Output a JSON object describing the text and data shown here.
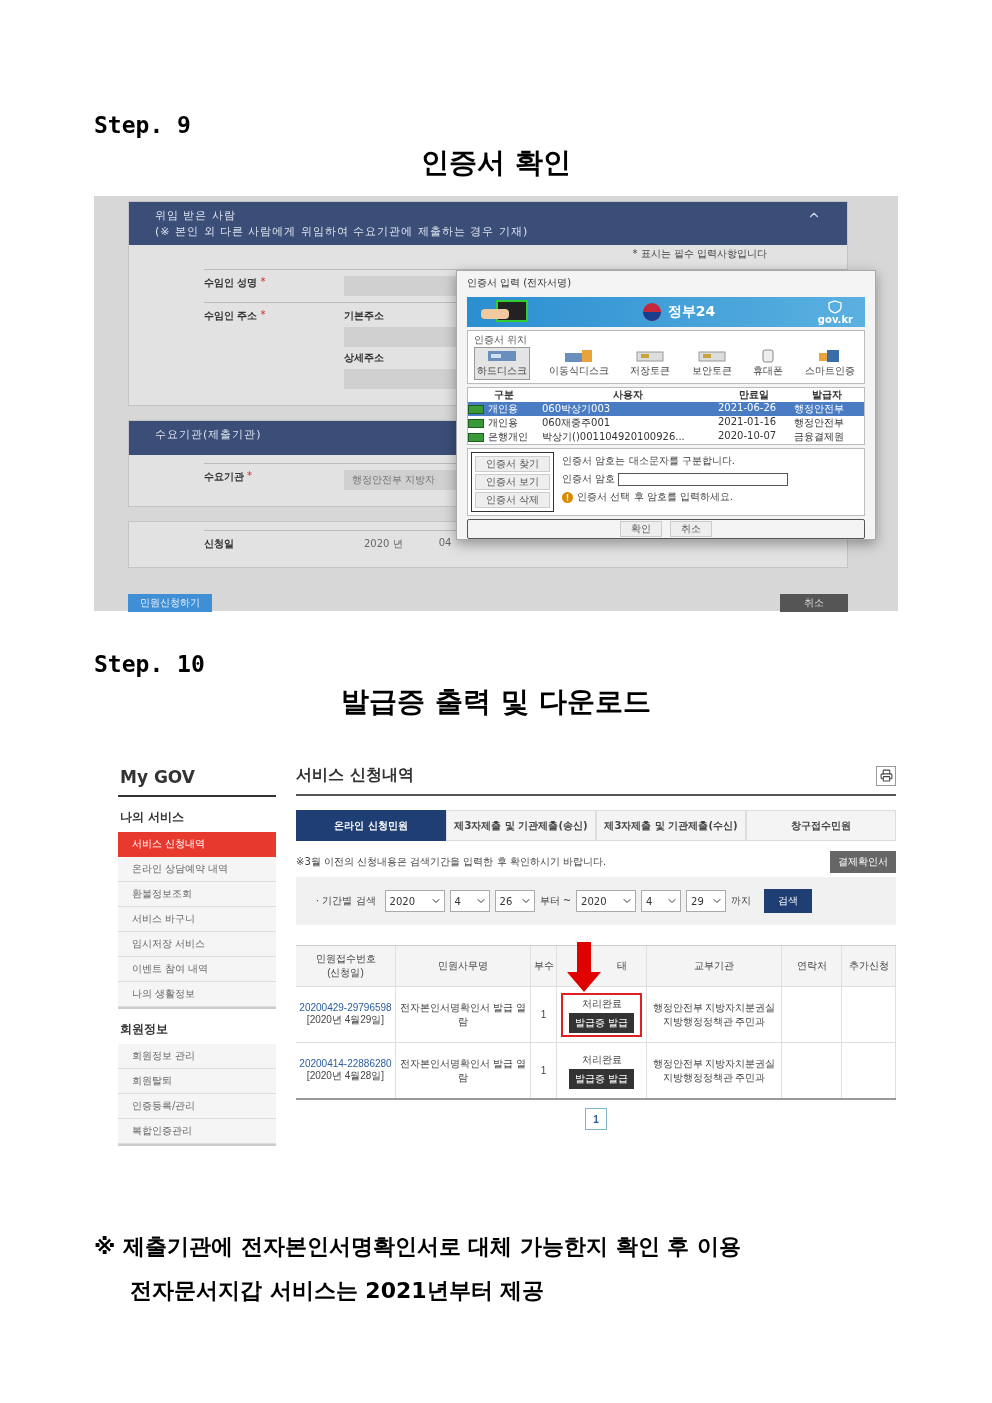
{
  "steps": [
    {
      "label": "Step. 9",
      "title": "인증서 확인"
    },
    {
      "label": "Step. 10",
      "title": "발급증 출력 및 다운로드"
    }
  ],
  "step9": {
    "panels": [
      {
        "header": [
          "위임 받은 사람",
          "(※ 본인 외 다른 사람에게 위임하여 수요기관에 제출하는 경우 기재)"
        ],
        "note": "* 표시는 필수 입력사항입니다",
        "fields": [
          {
            "label": "수임인 성명",
            "mark": "*",
            "kind": "input"
          },
          {
            "label": "수임인 주소",
            "mark": "*",
            "kind": "input",
            "inputs": [
              {
                "sublabel": "기본주소"
              },
              {
                "sublabel": "상세주소"
              }
            ]
          }
        ]
      },
      {
        "header": [
          "수요기관(제출기관)"
        ],
        "fields": [
          {
            "label": "수요기관",
            "mark": "*",
            "kind": "input",
            "value": "행정안전부 지방자"
          }
        ]
      },
      {
        "fields": [
          {
            "label": "신청일",
            "kind": "date",
            "date": [
              "2020 년",
              "04"
            ]
          }
        ]
      }
    ],
    "submit": "민원신청하기",
    "cancel": "취소",
    "dialog": {
      "title": "인증서 입력 (전자서명)",
      "brand": "정부24",
      "brand_domain": "gov.kr",
      "location_legend": "인증서 위치",
      "locations": [
        {
          "kind": "disk",
          "label": "하드디스크",
          "selected": true
        },
        {
          "kind": "removable",
          "label": "이동식디스크",
          "selected": false
        },
        {
          "kind": "token",
          "label": "저장토큰",
          "selected": false
        },
        {
          "kind": "token",
          "label": "보안토큰",
          "selected": false
        },
        {
          "kind": "phone",
          "label": "휴대폰",
          "selected": false
        },
        {
          "kind": "smart",
          "label": "스마트인증",
          "selected": false
        }
      ],
      "columns": [
        "구분",
        "사용자",
        "만료일",
        "발급자"
      ],
      "certificates": [
        {
          "type": "개인용",
          "user": "060박상기003",
          "expires": "2021-06-26",
          "issuer": "행정안전부",
          "selected": true
        },
        {
          "type": "개인용",
          "user": "060재중주001",
          "expires": "2021-01-16",
          "issuer": "행정안전부",
          "selected": false
        },
        {
          "type": "은행개인",
          "user": "박상기()001104920100926...",
          "expires": "2020-10-07",
          "issuer": "금융결제원",
          "selected": false
        }
      ],
      "actions": [
        "인증서 찾기",
        "인증서 보기",
        "인증서 삭제"
      ],
      "case_note": "인증서 암호는 대소문자를 구분합니다.",
      "password_label": "인증서 암호",
      "warning": "인증서 선택 후 암호를 입력하세요.",
      "buttons": [
        "확인",
        "취소"
      ]
    }
  },
  "step10": {
    "brand": "My GOV",
    "sidebar": [
      {
        "title": "나의 서비스",
        "items": [
          {
            "label": "서비스 신청내역",
            "selected": true
          },
          {
            "label": "온라인 상담예약 내역",
            "selected": false
          },
          {
            "label": "환불정보조회",
            "selected": false
          },
          {
            "label": "서비스 바구니",
            "selected": false
          },
          {
            "label": "임시저장 서비스",
            "selected": false
          },
          {
            "label": "이벤트 참여 내역",
            "selected": false
          },
          {
            "label": "나의 생활정보",
            "selected": false
          }
        ]
      },
      {
        "title": "회원정보",
        "items": [
          {
            "label": "회원정보 관리",
            "selected": false
          },
          {
            "label": "회원탈퇴",
            "selected": false
          },
          {
            "label": "인증등록/관리",
            "selected": false
          },
          {
            "label": "복합인증관리",
            "selected": false
          }
        ]
      }
    ],
    "page_title": "서비스 신청내역",
    "tabs": [
      {
        "label": "온라인 신청민원",
        "selected": true
      },
      {
        "label": "제3자제출 및 기관제출(송신)",
        "selected": false
      },
      {
        "label": "제3자제출 및 기관제출(수신)",
        "selected": false
      },
      {
        "label": "창구접수민원",
        "selected": false
      }
    ],
    "notice": "※3월 이전의 신청내용은 검색기간을 입력한 후 확인하시기 바랍니다.",
    "receipt_button": "결제확인서",
    "search": {
      "label": "· 기간별 검색",
      "from": [
        "2020",
        "4",
        "26"
      ],
      "from_suffix": "부터 ~",
      "to": [
        "2020",
        "4",
        "29"
      ],
      "to_suffix": "까지",
      "button": "검색"
    },
    "columns": [
      [
        "민원접수번호",
        "(신청일)"
      ],
      [
        "민원사무명"
      ],
      [
        "부수"
      ],
      [
        "태"
      ],
      [
        "교부기관"
      ],
      [
        "연락처"
      ],
      [
        "추가신청"
      ]
    ],
    "rows": [
      {
        "number": "20200429-29796598",
        "date": "[2020년 4월29일]",
        "name": "전자본인서명확인서 발급 열람",
        "copies": "1",
        "status": "처리완료",
        "action": "발급증 발급",
        "agency": [
          "행정안전부 지방자치분권실",
          "지방행정정책관 주민과"
        ],
        "highlighted": true
      },
      {
        "number": "20200414-22886280",
        "date": "[2020년 4월28일]",
        "name": "전자본인서명확인서 발급 열람",
        "copies": "1",
        "status": "처리완료",
        "action": "발급증 발급",
        "agency": [
          "행정안전부 지방자치분권실",
          "지방행정정책관 주민과"
        ],
        "highlighted": false
      }
    ],
    "pages": [
      {
        "label": "1",
        "selected": true
      }
    ]
  },
  "footnote": [
    "※ 제출기관에 전자본인서명확인서로 대체 가능한지 확인 후 이용",
    "전자문서지갑 서비스는 2021년부터 제공"
  ]
}
